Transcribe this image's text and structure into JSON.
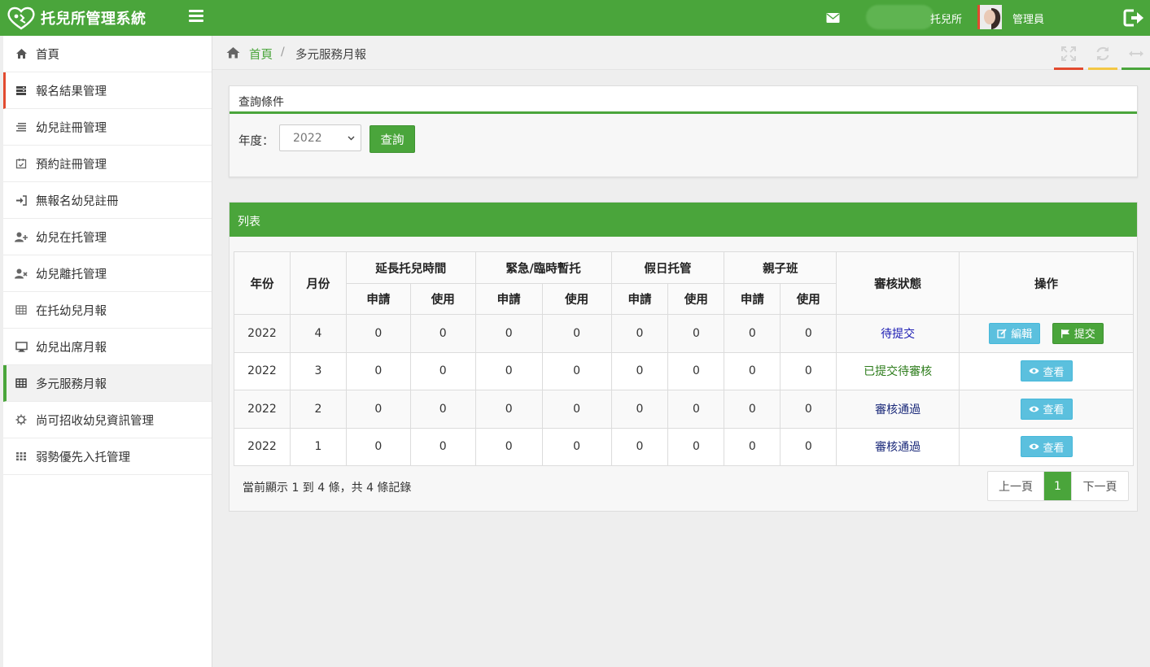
{
  "app": {
    "title": "托兒所管理系統",
    "org_name": "托兒所",
    "user_name": "管理員",
    "accent_color": "#4aa53b"
  },
  "header": {
    "menu_icon": "hamburger-icon",
    "mail_icon": "envelope-icon",
    "logout_icon": "logout-icon"
  },
  "sidebar": {
    "items": [
      {
        "label": "首頁",
        "icon": "home-icon"
      },
      {
        "label": "報名結果管理",
        "icon": "server-icon"
      },
      {
        "label": "幼兒註冊管理",
        "icon": "list-icon"
      },
      {
        "label": "預約註冊管理",
        "icon": "calendar-check-icon"
      },
      {
        "label": "無報名幼兒註冊",
        "icon": "sign-in-icon"
      },
      {
        "label": "幼兒在托管理",
        "icon": "user-plus-icon"
      },
      {
        "label": "幼兒離托管理",
        "icon": "user-times-icon"
      },
      {
        "label": "在托幼兒月報",
        "icon": "table-icon"
      },
      {
        "label": "幼兒出席月報",
        "icon": "desktop-icon"
      },
      {
        "label": "多元服務月報",
        "icon": "table-icon"
      },
      {
        "label": "尚可招收幼兒資訊管理",
        "icon": "gear-icon"
      },
      {
        "label": "弱勢優先入托管理",
        "icon": "grid-icon"
      }
    ]
  },
  "breadcrumb": {
    "home": "首頁",
    "separator": "/",
    "current": "多元服務月報"
  },
  "query_panel": {
    "title": "查詢條件",
    "year_label": "年度：",
    "year_value": "2022",
    "query_button": "查詢"
  },
  "list_panel": {
    "title": "列表",
    "headers": {
      "year": "年份",
      "month": "月份",
      "groups": [
        "延長托兒時間",
        "緊急/臨時暫托",
        "假日托管",
        "親子班"
      ],
      "apply": "申請",
      "use": "使用",
      "status": "審核狀態",
      "action": "操作"
    },
    "rows": [
      {
        "year": "2022",
        "month": "4",
        "vals": [
          "0",
          "0",
          "0",
          "0",
          "0",
          "0",
          "0",
          "0"
        ],
        "status": "待提交"
      },
      {
        "year": "2022",
        "month": "3",
        "vals": [
          "0",
          "0",
          "0",
          "0",
          "0",
          "0",
          "0",
          "0"
        ],
        "status": "已提交待審核"
      },
      {
        "year": "2022",
        "month": "2",
        "vals": [
          "0",
          "0",
          "0",
          "0",
          "0",
          "0",
          "0",
          "0"
        ],
        "status": "審核通過"
      },
      {
        "year": "2022",
        "month": "1",
        "vals": [
          "0",
          "0",
          "0",
          "0",
          "0",
          "0",
          "0",
          "0"
        ],
        "status": "審核通過"
      }
    ],
    "buttons": {
      "edit": "編輯",
      "submit": "提交",
      "view": "查看"
    },
    "footer_info": "當前顯示 1 到 4 條，共 4 條記錄",
    "pager": {
      "prev": "上一頁",
      "current": "1",
      "next": "下一頁"
    }
  }
}
